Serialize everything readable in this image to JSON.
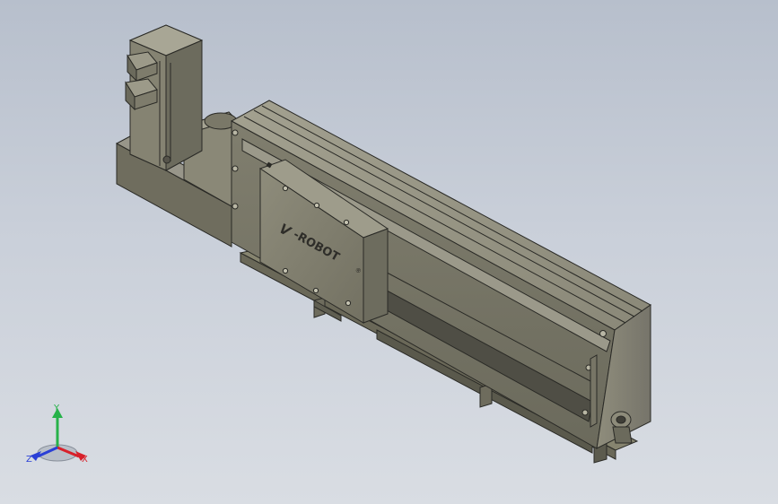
{
  "viewport": {
    "background_top": "#b7bfcc",
    "background_bottom": "#d9dde3"
  },
  "model": {
    "logo_text": "-ROBOT",
    "logo_mark": "®",
    "body_color": "#7d7b6b",
    "body_light": "#9a9887",
    "body_dark": "#55534a",
    "edge_color": "#2a2a26"
  },
  "triad": {
    "x_label": "X",
    "y_label": "Y",
    "z_label": "Z",
    "x_color": "#d8202a",
    "y_color": "#27b24a",
    "z_color": "#2a3fd6"
  }
}
